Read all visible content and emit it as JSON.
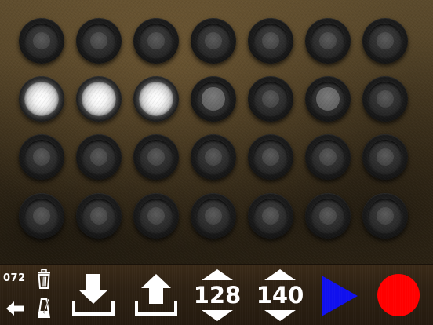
{
  "pads": {
    "rows": [
      [
        "off",
        "off",
        "off",
        "off",
        "off",
        "off",
        "off"
      ],
      [
        "lit",
        "lit",
        "lit",
        "dim",
        "off",
        "dim",
        "off"
      ],
      [
        "off",
        "off",
        "off",
        "off",
        "off",
        "off",
        "off"
      ],
      [
        "off",
        "off",
        "off",
        "off",
        "off",
        "off",
        "off"
      ]
    ]
  },
  "toolbar": {
    "tempo_counter": "072",
    "stepper_a_value": "128",
    "stepper_b_value": "140",
    "icons": {
      "trash": "trash-icon",
      "back": "back-arrow-icon",
      "metronome": "metronome-icon",
      "download": "download-icon",
      "upload": "upload-icon",
      "play": "play-icon",
      "record": "record-icon"
    },
    "colors": {
      "play": "#1010ee",
      "record": "#ff0000"
    }
  }
}
